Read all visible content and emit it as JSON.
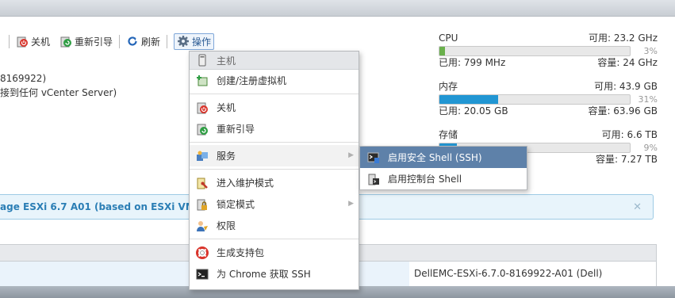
{
  "toolbar": {
    "shutdown_label": "关机",
    "reboot_label": "重新引导",
    "refresh_label": "刷新",
    "actions_label": "操作"
  },
  "host_info": {
    "line1": "8169922)",
    "line2": "接到任何 vCenter Server)"
  },
  "stats": {
    "cpu": {
      "label": "CPU",
      "free": "可用: 23.2 GHz",
      "pct": "3%",
      "used": "已用: 799 MHz",
      "capacity": "容量: 24 GHz",
      "fill_pct": 3,
      "color": "#6ab04c"
    },
    "memory": {
      "label": "内存",
      "free": "可用: 43.9 GB",
      "pct": "31%",
      "used": "已用: 20.05 GB",
      "capacity": "容量: 63.96 GB",
      "fill_pct": 31,
      "color": "#2196d3"
    },
    "storage": {
      "label": "存储",
      "free": "可用: 6.6 TB",
      "pct": "9%",
      "capacity": "容量: 7.27 TB"
    }
  },
  "banner": {
    "text": "age ESXi 6.7 A01 (based on ESXi VMKernel",
    "close": "✕"
  },
  "table": {
    "value": "DellEMC-ESXi-6.7.0-8169922-A01 (Dell)"
  },
  "menu": {
    "header": "主机",
    "items": [
      {
        "label": "创建/注册虚拟机"
      },
      {
        "label": "关机"
      },
      {
        "label": "重新引导"
      },
      {
        "label": "服务"
      },
      {
        "label": "进入维护模式"
      },
      {
        "label": "锁定模式"
      },
      {
        "label": "权限"
      },
      {
        "label": "生成支持包"
      },
      {
        "label": "为 Chrome 获取 SSH"
      }
    ]
  },
  "submenu": {
    "items": [
      {
        "label": "启用安全 Shell (SSH)"
      },
      {
        "label": "启用控制台 Shell"
      }
    ]
  },
  "colors": {
    "accent": "#5e81a9",
    "banner_text": "#2b7eb5"
  }
}
